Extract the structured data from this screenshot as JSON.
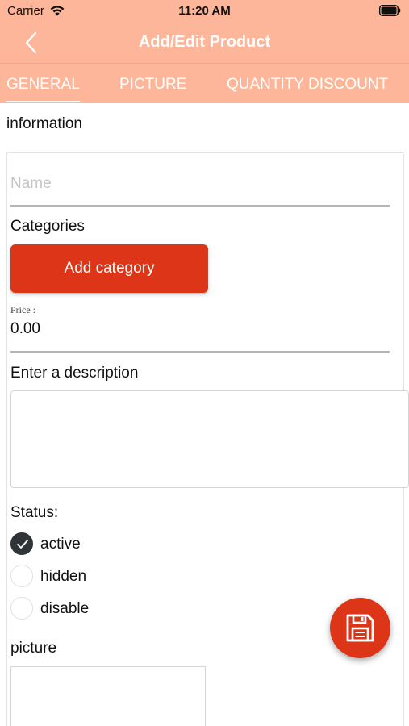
{
  "status_bar": {
    "carrier": "Carrier",
    "time": "11:20 AM"
  },
  "nav": {
    "title": "Add/Edit Product",
    "back_icon": "chevron-left-icon"
  },
  "tabs": [
    {
      "label": "GENERAL",
      "active": true
    },
    {
      "label": "PICTURE",
      "active": false
    },
    {
      "label": "QUANTITY DISCOUNT",
      "active": false
    }
  ],
  "form": {
    "section_title": "information",
    "name": {
      "value": "",
      "placeholder": "Name"
    },
    "categories_label": "Categories",
    "add_category_label": "Add category",
    "price_label": "Price :",
    "price_value": "0.00",
    "description_label": "Enter a description",
    "description_value": "",
    "status_label": "Status:",
    "status_options": [
      {
        "label": "active",
        "checked": true
      },
      {
        "label": "hidden",
        "checked": false
      },
      {
        "label": "disable",
        "checked": false
      }
    ],
    "picture_label": "picture"
  },
  "fab": {
    "icon": "save-icon"
  },
  "colors": {
    "header_bg": "#fdb69a",
    "header_text": "#ffffff",
    "accent": "#dc3518",
    "radio_checked": "#2f3437"
  }
}
